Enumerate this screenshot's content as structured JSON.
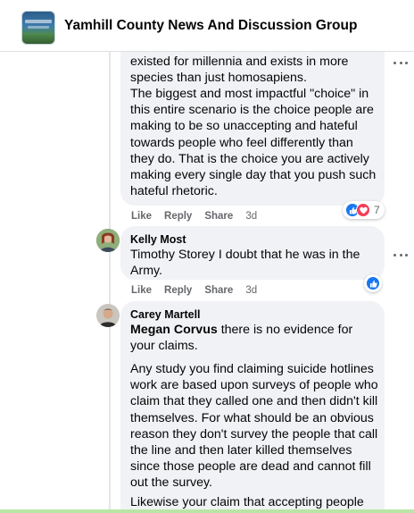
{
  "header": {
    "group_name": "Yamhill County News And Discussion Group"
  },
  "comments": [
    {
      "paragraphs": [
        "existed for millennia and exists in more species than just homosapiens.",
        "The biggest and most impactful \"choice\" in this entire scenario is the choice people are making to be so unaccepting and hateful towards people who feel differently than they do. That is the choice you are actively making every single day that you push such hateful rhetoric."
      ],
      "actions": {
        "like": "Like",
        "reply": "Reply",
        "share": "Share",
        "time": "3d"
      },
      "reactions": {
        "types": [
          "like",
          "love"
        ],
        "count": "7"
      }
    },
    {
      "author": "Kelly Most",
      "text": "Timothy Storey I doubt that he was in the Army.",
      "actions": {
        "like": "Like",
        "reply": "Reply",
        "share": "Share",
        "time": "3d"
      },
      "reactions": {
        "types": [
          "like"
        ],
        "count": ""
      }
    },
    {
      "author": "Carey Martell",
      "mention": "Megan Corvus",
      "first_line_rest": " there is no evidence for your claims.",
      "paragraphs": [
        "Any study you find claiming suicide hotlines work are based upon surveys of people who claim that they called one and then didn't kill themselves. For what should be an obvious reason they don't survey the people that call the line and then later killed themselves since those people are dead and cannot fill out the survey.",
        "Likewise your claim that accepting people as"
      ]
    }
  ],
  "colors": {
    "bubble_bg": "#f0f2f5",
    "like_blue": "#1877f2",
    "love_red": "#f33e58",
    "meta_gray": "#65676b"
  },
  "icons": [
    "group-cover-thumbnail",
    "like-reaction-icon",
    "love-reaction-icon",
    "more-options-icon",
    "user-avatar"
  ]
}
